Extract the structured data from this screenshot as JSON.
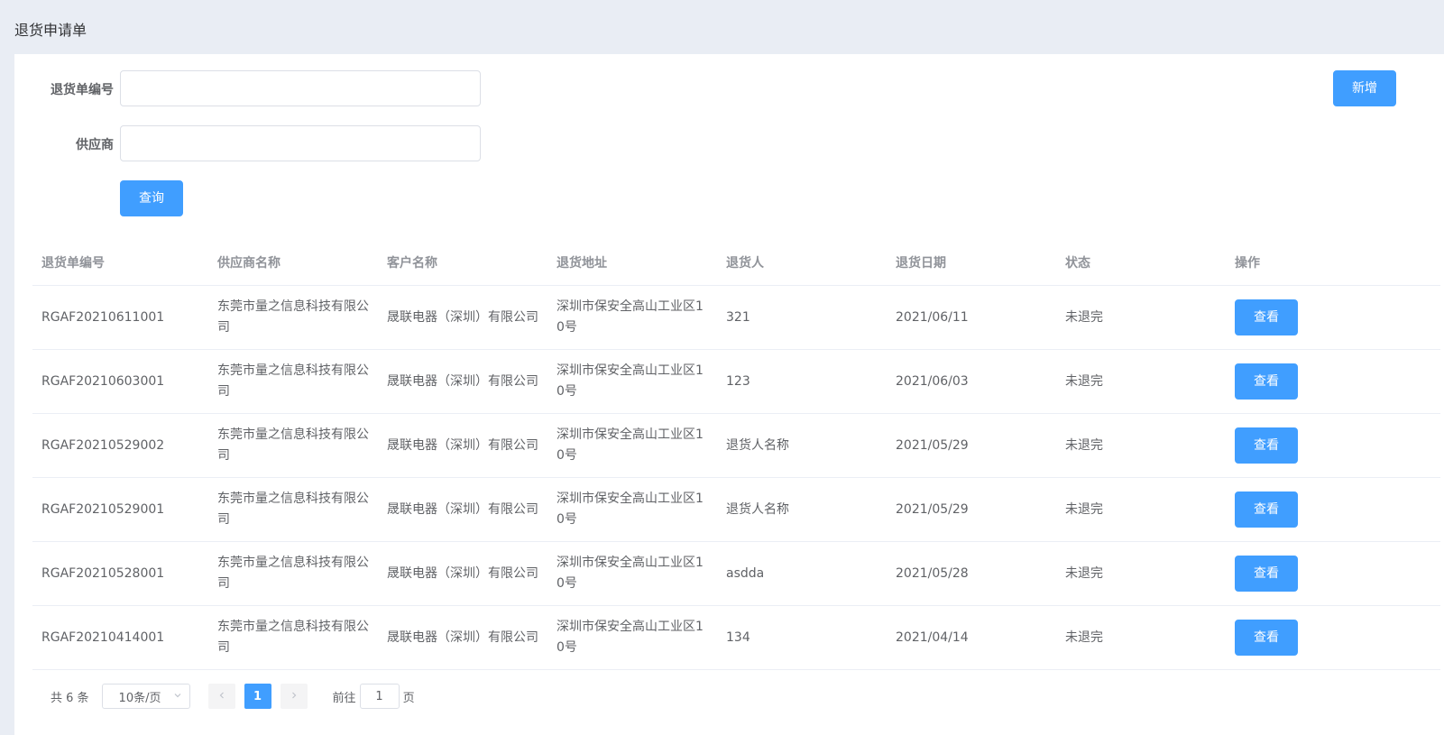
{
  "page": {
    "title": "退货申请单"
  },
  "search": {
    "order_no_label": "退货单编号",
    "order_no_value": "",
    "supplier_label": "供应商",
    "supplier_value": "",
    "query_label": "查询"
  },
  "toolbar": {
    "add_label": "新增"
  },
  "table": {
    "columns": [
      "退货单编号",
      "供应商名称",
      "客户名称",
      "退货地址",
      "退货人",
      "退货日期",
      "状态",
      "操作"
    ],
    "rows": [
      {
        "order_no": "RGAF20210611001",
        "supplier": "东莞市量之信息科技有限公司",
        "customer": "晟联电器（深圳）有限公司",
        "address": "深圳市保安全高山工业区10号",
        "person": "321",
        "date": "2021/06/11",
        "status": "未退完",
        "action": "查看"
      },
      {
        "order_no": "RGAF20210603001",
        "supplier": "东莞市量之信息科技有限公司",
        "customer": "晟联电器（深圳）有限公司",
        "address": "深圳市保安全高山工业区10号",
        "person": "123",
        "date": "2021/06/03",
        "status": "未退完",
        "action": "查看"
      },
      {
        "order_no": "RGAF20210529002",
        "supplier": "东莞市量之信息科技有限公司",
        "customer": "晟联电器（深圳）有限公司",
        "address": "深圳市保安全高山工业区10号",
        "person": "退货人名称",
        "date": "2021/05/29",
        "status": "未退完",
        "action": "查看"
      },
      {
        "order_no": "RGAF20210529001",
        "supplier": "东莞市量之信息科技有限公司",
        "customer": "晟联电器（深圳）有限公司",
        "address": "深圳市保安全高山工业区10号",
        "person": "退货人名称",
        "date": "2021/05/29",
        "status": "未退完",
        "action": "查看"
      },
      {
        "order_no": "RGAF20210528001",
        "supplier": "东莞市量之信息科技有限公司",
        "customer": "晟联电器（深圳）有限公司",
        "address": "深圳市保安全高山工业区10号",
        "person": "asdda",
        "date": "2021/05/28",
        "status": "未退完",
        "action": "查看"
      },
      {
        "order_no": "RGAF20210414001",
        "supplier": "东莞市量之信息科技有限公司",
        "customer": "晟联电器（深圳）有限公司",
        "address": "深圳市保安全高山工业区10号",
        "person": "134",
        "date": "2021/04/14",
        "status": "未退完",
        "action": "查看"
      }
    ]
  },
  "pagination": {
    "total_label": "共 6 条",
    "page_size": "10条/页",
    "current_page": "1",
    "goto_label": "前往",
    "goto_value": "1",
    "goto_suffix": "页"
  },
  "icons": {
    "prev": "chevron-left-icon",
    "next": "chevron-right-icon",
    "dropdown": "chevron-down-icon"
  },
  "colors": {
    "primary": "#409eff",
    "background": "#e9edf4"
  }
}
